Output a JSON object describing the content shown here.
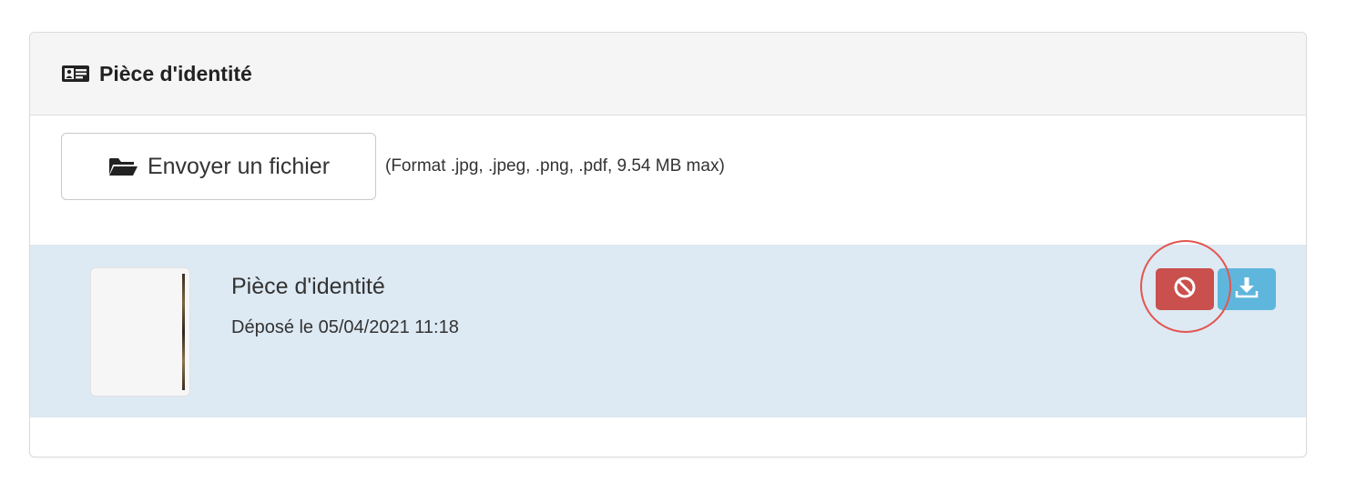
{
  "panel": {
    "title": "Pièce d'identité",
    "title_icon": "id-card-icon"
  },
  "upload": {
    "button_label": "Envoyer un fichier",
    "button_icon": "folder-open-icon",
    "format_hint": "(Format .jpg, .jpeg, .png, .pdf, 9.54 MB max)"
  },
  "file": {
    "name": "Pièce d'identité",
    "uploaded": "Déposé le 05/04/2021 11:18",
    "delete_icon": "ban-icon",
    "download_icon": "download-icon"
  },
  "colors": {
    "row_highlight": "#dde9f3",
    "delete": "#c9504d",
    "download": "#5fb6dc",
    "annotation_ring": "#e2554f"
  }
}
